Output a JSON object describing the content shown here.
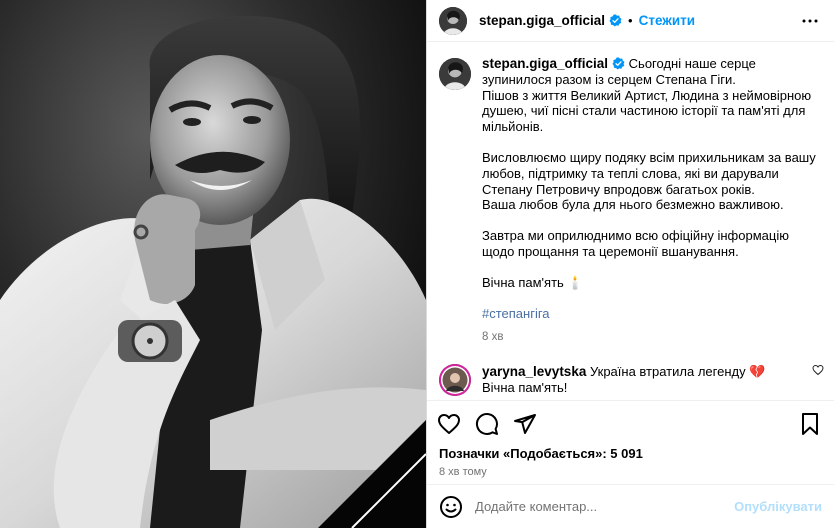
{
  "header": {
    "username": "stepan.giga_official",
    "separator": "•",
    "follow_label": "Стежити"
  },
  "post": {
    "username": "stepan.giga_official",
    "paragraph_1": "Сьогодні наше серце зупинилося разом із серцем Степана Гіги.\nПішов з життя Великий Артист, Людина з неймовірною душею, чиї пісні стали частиною історії та пам'яті для мільйонів.",
    "paragraph_2": "Висловлюємо щиру подяку всім прихильникам за вашу любов, підтримку та теплі слова, які ви дарували Степану Петровичу впродовж багатьох років.\nВаша любов була для нього безмежно важливою.",
    "paragraph_3": "Завтра ми оприлюднимо всю офіційну інформацію щодо прощання та церемонії вшанування.",
    "paragraph_4": "Вічна пам'ять 🕯️",
    "hashtag": "#степангіга",
    "time": "8 хв"
  },
  "comment": {
    "username": "yaryna_levytska",
    "text_line_1": "Україна втратила легенду 💔",
    "text_line_2": "Вічна пам'ять!"
  },
  "likes": {
    "label": "Позначки «Подобається»: 5 091"
  },
  "timestamp": "8 хв тому",
  "add_comment": {
    "placeholder": "Додайте коментар...",
    "publish_label": "Опублікувати"
  },
  "icons": {
    "like": "heart-icon",
    "comment": "comment-icon",
    "share": "send-icon",
    "save": "bookmark-icon",
    "emoji": "emoji-icon",
    "verified": "verified-badge-icon",
    "more": "more-icon"
  },
  "colors": {
    "accent": "#0095f6",
    "publish_disabled": "#b2dffc",
    "secondary_text": "#737373",
    "hashtag": "#4a6fa5"
  }
}
